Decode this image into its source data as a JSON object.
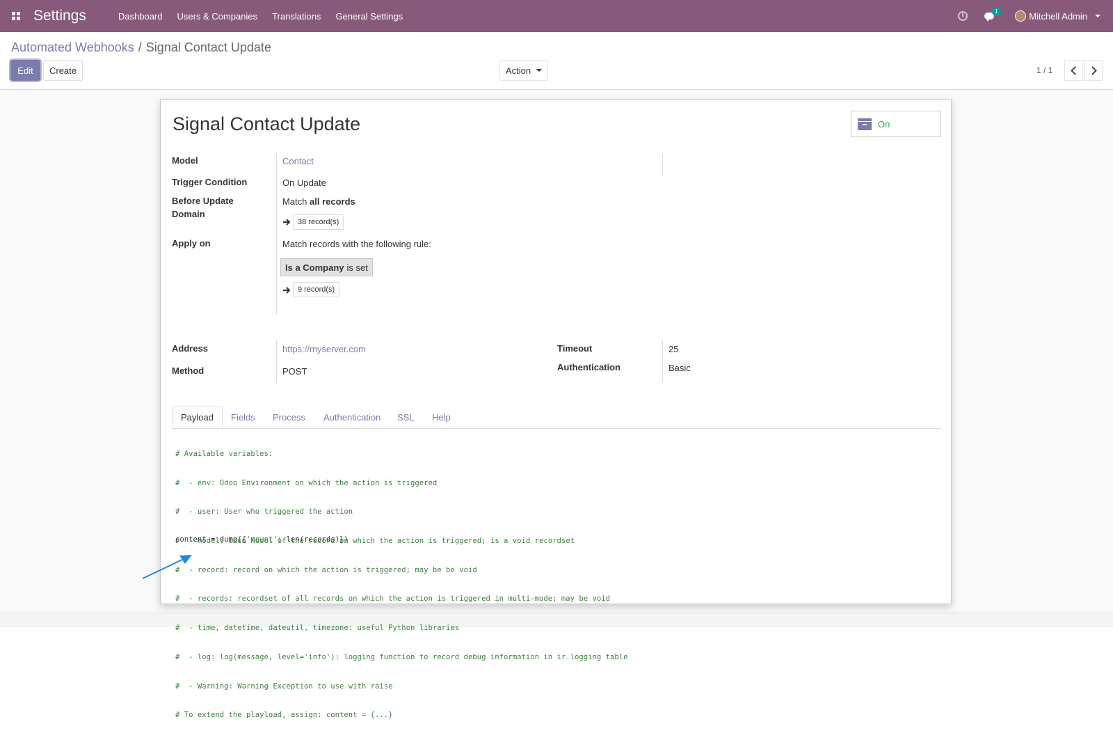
{
  "navbar": {
    "app_title": "Settings",
    "menu": [
      "Dashboard",
      "Users & Companies",
      "Translations",
      "General Settings"
    ],
    "message_count": "1",
    "user_name": "Mitchell Admin"
  },
  "breadcrumb": {
    "parent": "Automated Webhooks",
    "separator": "/",
    "current": "Signal Contact Update"
  },
  "buttons": {
    "edit": "Edit",
    "create": "Create",
    "action": "Action"
  },
  "pager": {
    "value": "1 / 1"
  },
  "record": {
    "title": "Signal Contact Update",
    "active_label": "On",
    "model_label": "Model",
    "model_value": "Contact",
    "trigger_label": "Trigger Condition",
    "trigger_value": "On Update",
    "before_domain_label_1": "Before Update",
    "before_domain_label_2": "Domain",
    "before_match_prefix": "Match",
    "before_match_bold": "all records",
    "before_records": "38 record(s)",
    "apply_on_label": "Apply on",
    "apply_on_text": "Match records with the following rule:",
    "rule_field": "Is a Company",
    "rule_op": "is set",
    "apply_records": "9 record(s)",
    "address_label": "Address",
    "address_value": "https://myserver.com",
    "method_label": "Method",
    "method_value": "POST",
    "timeout_label": "Timeout",
    "timeout_value": "25",
    "auth_label": "Authentication",
    "auth_value": "Basic"
  },
  "tabs": [
    "Payload",
    "Fields",
    "Process",
    "Authentication",
    "SSL",
    "Help"
  ],
  "code": {
    "comments": [
      "# Available variables:",
      "#  - env: Odoo Environment on which the action is triggered",
      "#  - user: User who triggered the action",
      "#  - model: Odoo Model of the record on which the action is triggered; is a void recordset",
      "#  - record: record on which the action is triggered; may be be void",
      "#  - records: recordset of all records on which the action is triggered in multi-mode; may be void",
      "#  - time, datetime, dateutil, timezone: useful Python libraries",
      "#  - log: log(message, level='info'): logging function to record debug information in ir.logging table",
      "#  - Warning: Warning Exception to use with raise",
      "# To extend the playload, assign: content = {...}"
    ],
    "line_prefix": "content = dump({",
    "line_string": "'count'",
    "line_suffix": ": len(records)})"
  },
  "colors": {
    "navbar": "#875A7B",
    "accent": "#7C7BAD",
    "active_green": "#28a745",
    "comment_green": "#408040",
    "annotation_blue": "#1E88E5"
  }
}
